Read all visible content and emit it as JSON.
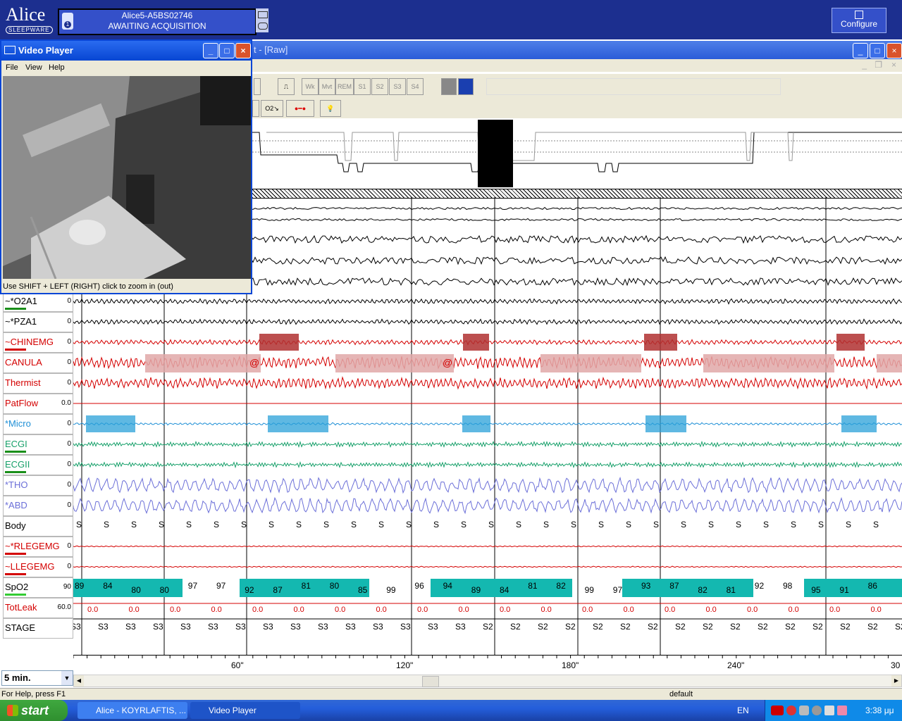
{
  "app": {
    "logo_text": "Alice",
    "logo_sub": "SLEEPWARE",
    "device_id": "Alice5-A5BS02746",
    "device_status": "AWAITING ACQUISITION",
    "device_badge": "1",
    "configure_label": "Configure"
  },
  "main_window": {
    "title_fragment": "t - [Raw]",
    "minimize": "_",
    "maximize": "□",
    "close": "×"
  },
  "toolbar": {
    "stage_buttons": [
      "Wk",
      "Mvt",
      "REM",
      "S1",
      "S2",
      "S3",
      "S4"
    ],
    "o2_label": "O2↘"
  },
  "video_player": {
    "title": "Video Player",
    "menu": [
      "File",
      "View",
      "Help"
    ],
    "hint": "Use SHIFT + LEFT (RIGHT) click to zoom in (out)"
  },
  "channels": [
    {
      "name": "~*O2A1",
      "scale": "0",
      "color": "#000000",
      "bar": "#1a8f1a"
    },
    {
      "name": "~*PZA1",
      "scale": "0",
      "color": "#000000",
      "bar": ""
    },
    {
      "name": "~CHINEMG",
      "scale": "0",
      "color": "#d40000",
      "bar": "#d40000"
    },
    {
      "name": "CANULA",
      "scale": "0",
      "color": "#d40000",
      "bar": ""
    },
    {
      "name": "Thermist",
      "scale": "0",
      "color": "#d40000",
      "bar": ""
    },
    {
      "name": "PatFlow",
      "scale": "0.0",
      "color": "#d40000",
      "bar": ""
    },
    {
      "name": "*Micro",
      "scale": "0",
      "color": "#1e8fd6",
      "bar": ""
    },
    {
      "name": "ECGI",
      "scale": "0",
      "color": "#17a06a",
      "bar": "#1a8f1a"
    },
    {
      "name": "ECGII",
      "scale": "0",
      "color": "#17a06a",
      "bar": "#1a8f1a"
    },
    {
      "name": "*THO",
      "scale": "0",
      "color": "#6b6fd8",
      "bar": ""
    },
    {
      "name": "*ABD",
      "scale": "0",
      "color": "#6b6fd8",
      "bar": ""
    },
    {
      "name": "Body",
      "scale": "",
      "color": "#000000",
      "bar": ""
    },
    {
      "name": "~*RLEGEMG",
      "scale": "0",
      "color": "#d40000",
      "bar": "#d40000"
    },
    {
      "name": "~LLEGEMG",
      "scale": "0",
      "color": "#d40000",
      "bar": "#d40000"
    },
    {
      "name": "SpO2",
      "scale": "90",
      "color": "#000000",
      "bar": "#33cc33"
    },
    {
      "name": "TotLeak",
      "scale": "60.0",
      "color": "#d40000",
      "bar": ""
    },
    {
      "name": "STAGE",
      "scale": "",
      "color": "#000000",
      "bar": ""
    }
  ],
  "body_position_label": "S",
  "canula_event_marker": "@",
  "spo2_values": [
    "89",
    "84",
    "80",
    "80",
    "97",
    "97",
    "92",
    "87",
    "81",
    "80",
    "85",
    "99",
    "96",
    "94",
    "89",
    "84",
    "81",
    "82",
    "99",
    "97",
    "93",
    "87",
    "82",
    "81",
    "92",
    "98",
    "95",
    "91",
    "86"
  ],
  "totleak_value": "0.0",
  "stage_labels": [
    "S3",
    "S3",
    "S3",
    "S3",
    "S3",
    "S3",
    "S3",
    "S3",
    "S3",
    "S3",
    "S3",
    "S3",
    "S3",
    "S3",
    "S3",
    "S2",
    "S2",
    "S2",
    "S2",
    "S2",
    "S2",
    "S2",
    "S2",
    "S2",
    "S2",
    "S2",
    "S2",
    "S2",
    "S2",
    "S2",
    "S2"
  ],
  "time_axis": {
    "ticks": [
      "60\"",
      "120\"",
      "180\"",
      "240\"",
      "30"
    ]
  },
  "zoom_select": "5 min.",
  "status": {
    "help": "For Help, press F1",
    "profile": "default"
  },
  "taskbar": {
    "start": "start",
    "items": [
      "Alice - KOYRLAFTIS, ...",
      "Video Player"
    ],
    "language": "EN",
    "clock": "3:38 μμ"
  },
  "colors": {
    "alice_bar": "#1c2f8f",
    "spo2_fill": "#14b8b0",
    "event_box": "#b03030",
    "apnea_box": "#e0a8a8"
  }
}
